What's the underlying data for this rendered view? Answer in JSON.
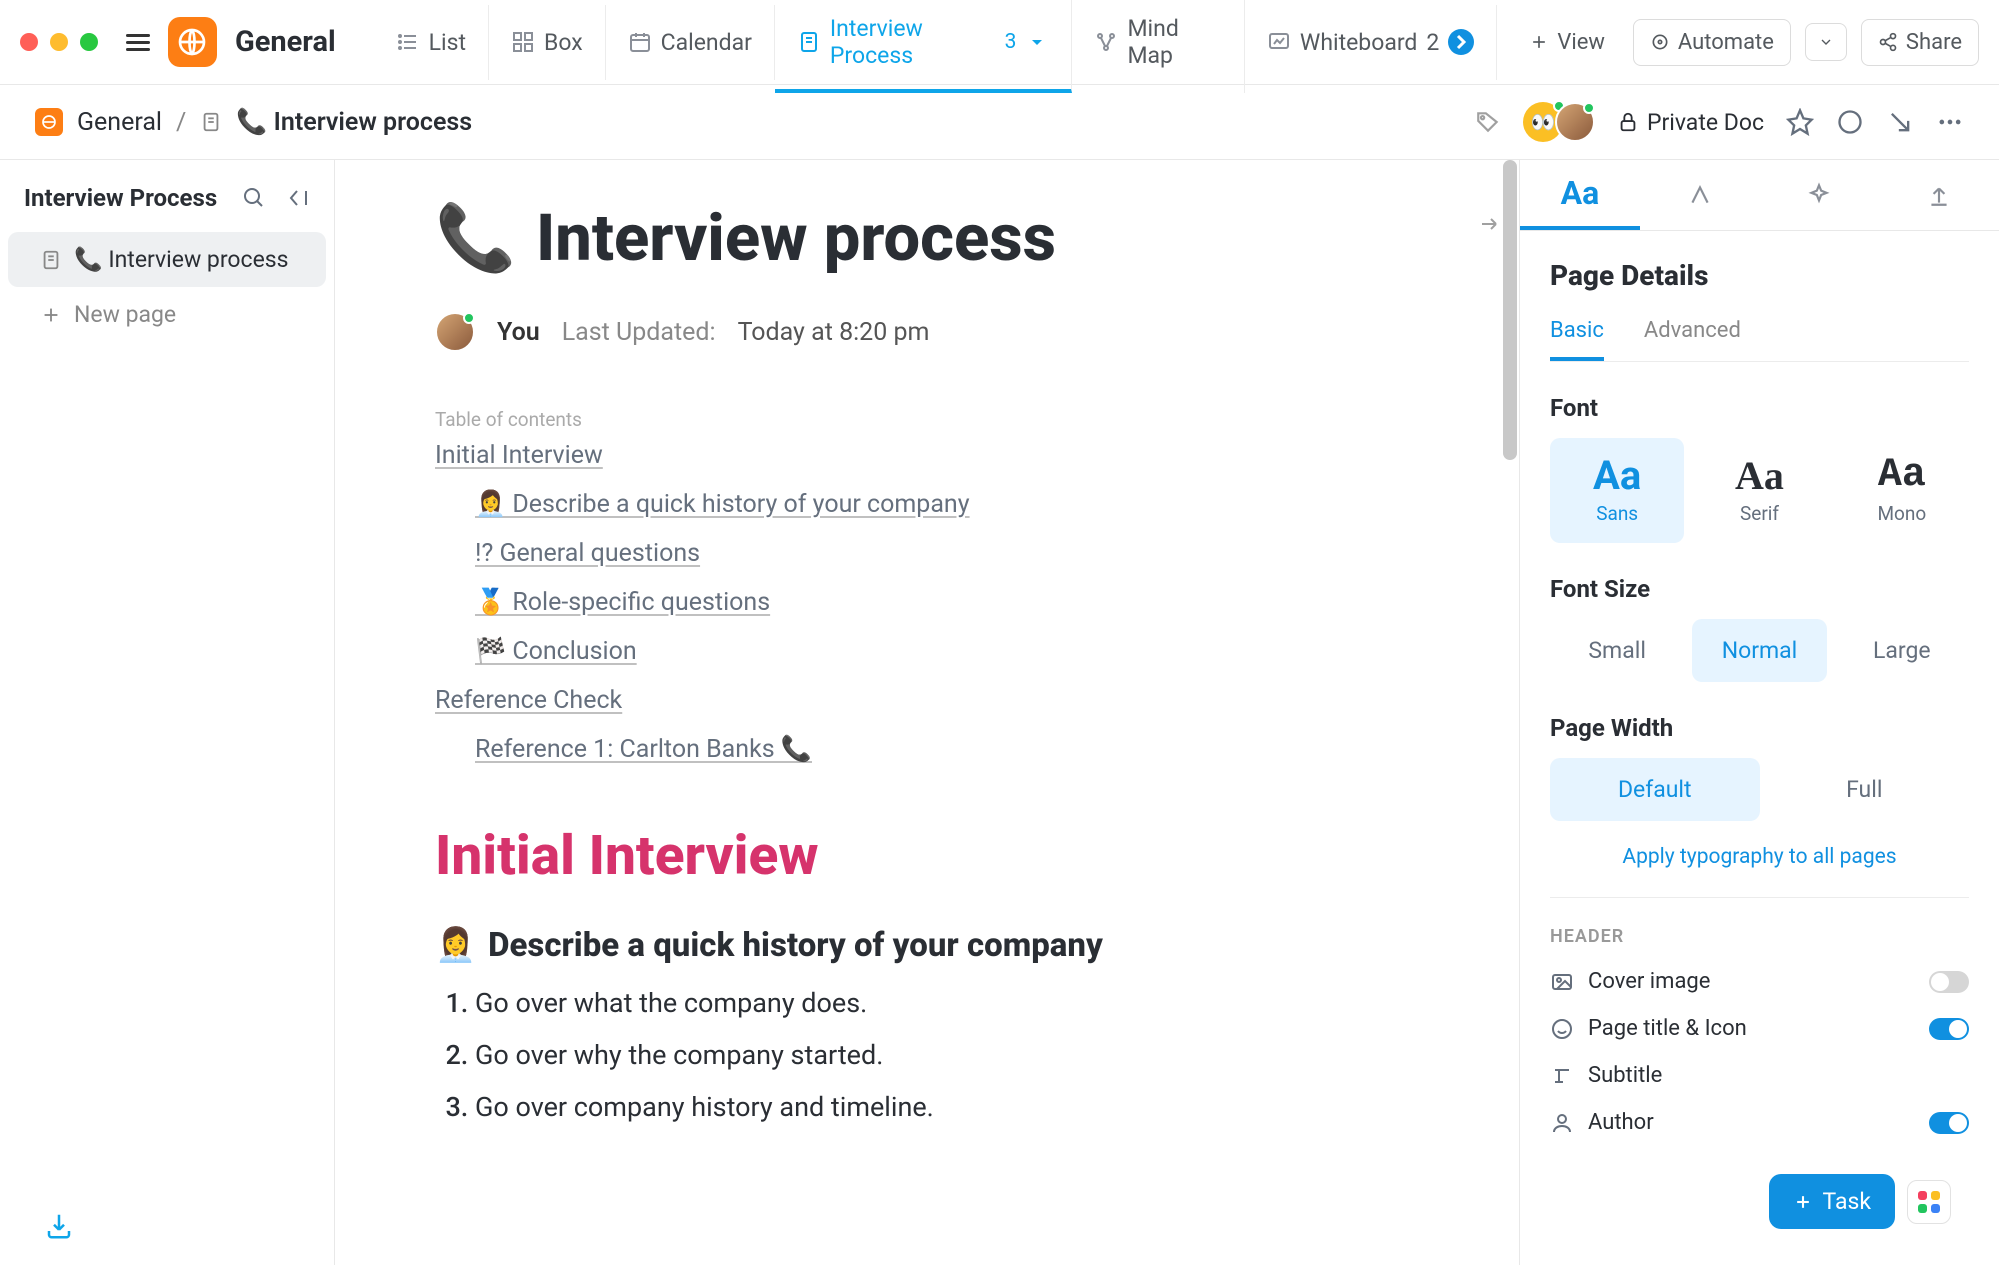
{
  "header": {
    "workspace": "General",
    "views": {
      "list": "List",
      "box": "Box",
      "calendar": "Calendar",
      "interview_process": {
        "label": "Interview Process",
        "count": "3"
      },
      "mind_map": "Mind Map",
      "whiteboard": {
        "label": "Whiteboard",
        "count": "2"
      },
      "view": "View",
      "automate": "Automate",
      "share": "Share"
    }
  },
  "breadcrumb": {
    "space": "General",
    "doc": "📞 Interview process",
    "privacy": "Private Doc"
  },
  "sidebar": {
    "title": "Interview Process",
    "pages": {
      "p0": "📞 Interview process",
      "new": "New page"
    }
  },
  "doc": {
    "title_emoji": "📞",
    "title": "Interview process",
    "author": "You",
    "updated_label": "Last Updated:",
    "updated_value": "Today at 8:20 pm",
    "toc_label": "Table of contents",
    "toc": {
      "l1a": "Initial Interview",
      "l2a": "👩‍💼 Describe a quick history of your company",
      "l2b": "!? General questions",
      "l2c": "🏅 Role-specific questions",
      "l2d": "🏁 Conclusion",
      "l1b": "Reference Check",
      "l2e": "Reference 1: Carlton Banks 📞"
    },
    "h1": "Initial Interview",
    "h2_emoji": "👩‍💼",
    "h2": "Describe a quick history of your company",
    "list": {
      "i1": "Go over what the company does.",
      "i2": "Go over why the company started.",
      "i3": "Go over company history and timeline."
    }
  },
  "rightpanel": {
    "title": "Page Details",
    "subtabs": {
      "basic": "Basic",
      "advanced": "Advanced"
    },
    "font": {
      "label": "Font",
      "sans": "Sans",
      "serif": "Serif",
      "mono": "Mono",
      "sample": "Aa"
    },
    "fontsize": {
      "label": "Font Size",
      "small": "Small",
      "normal": "Normal",
      "large": "Large"
    },
    "pagewidth": {
      "label": "Page Width",
      "default": "Default",
      "full": "Full"
    },
    "apply": "Apply typography to all pages",
    "header_label": "HEADER",
    "settings": {
      "cover": "Cover image",
      "titleicon": "Page title & Icon",
      "subtitle": "Subtitle",
      "author": "Author"
    }
  },
  "fab": {
    "task": "Task"
  }
}
